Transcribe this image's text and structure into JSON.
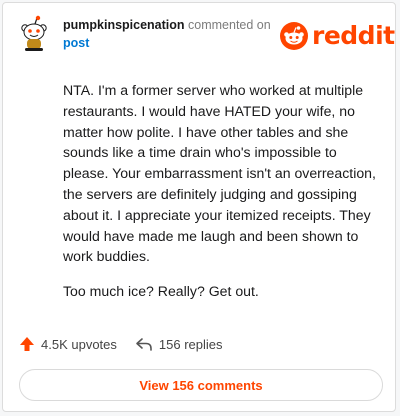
{
  "header": {
    "username": "pumpkinspicenation",
    "commented_on": "commented on",
    "post_link": "post",
    "logo_text": "reddit"
  },
  "comment": {
    "paragraphs": [
      "NTA. I'm a former server who worked at multiple restaurants. I would have HATED your wife, no matter how polite. I have other tables and she sounds like a time drain who's impossible to please. Your embarrassment isn't an overreaction, the servers are definitely judging and gossiping about it. I appreciate your itemized receipts. They would have made me laugh and been shown to work buddies.",
      "Too much ice? Really? Get out."
    ]
  },
  "actions": {
    "upvotes": "4.5K upvotes",
    "replies": "156 replies"
  },
  "view_comments": "View 156 comments",
  "colors": {
    "brand": "#ff4500",
    "link": "#0079d3",
    "text": "#1a1a1b",
    "muted": "#7c7c7c"
  },
  "icons": [
    "snoo-avatar-icon",
    "reddit-logo-icon",
    "upvote-arrow-icon",
    "reply-arrow-icon"
  ]
}
